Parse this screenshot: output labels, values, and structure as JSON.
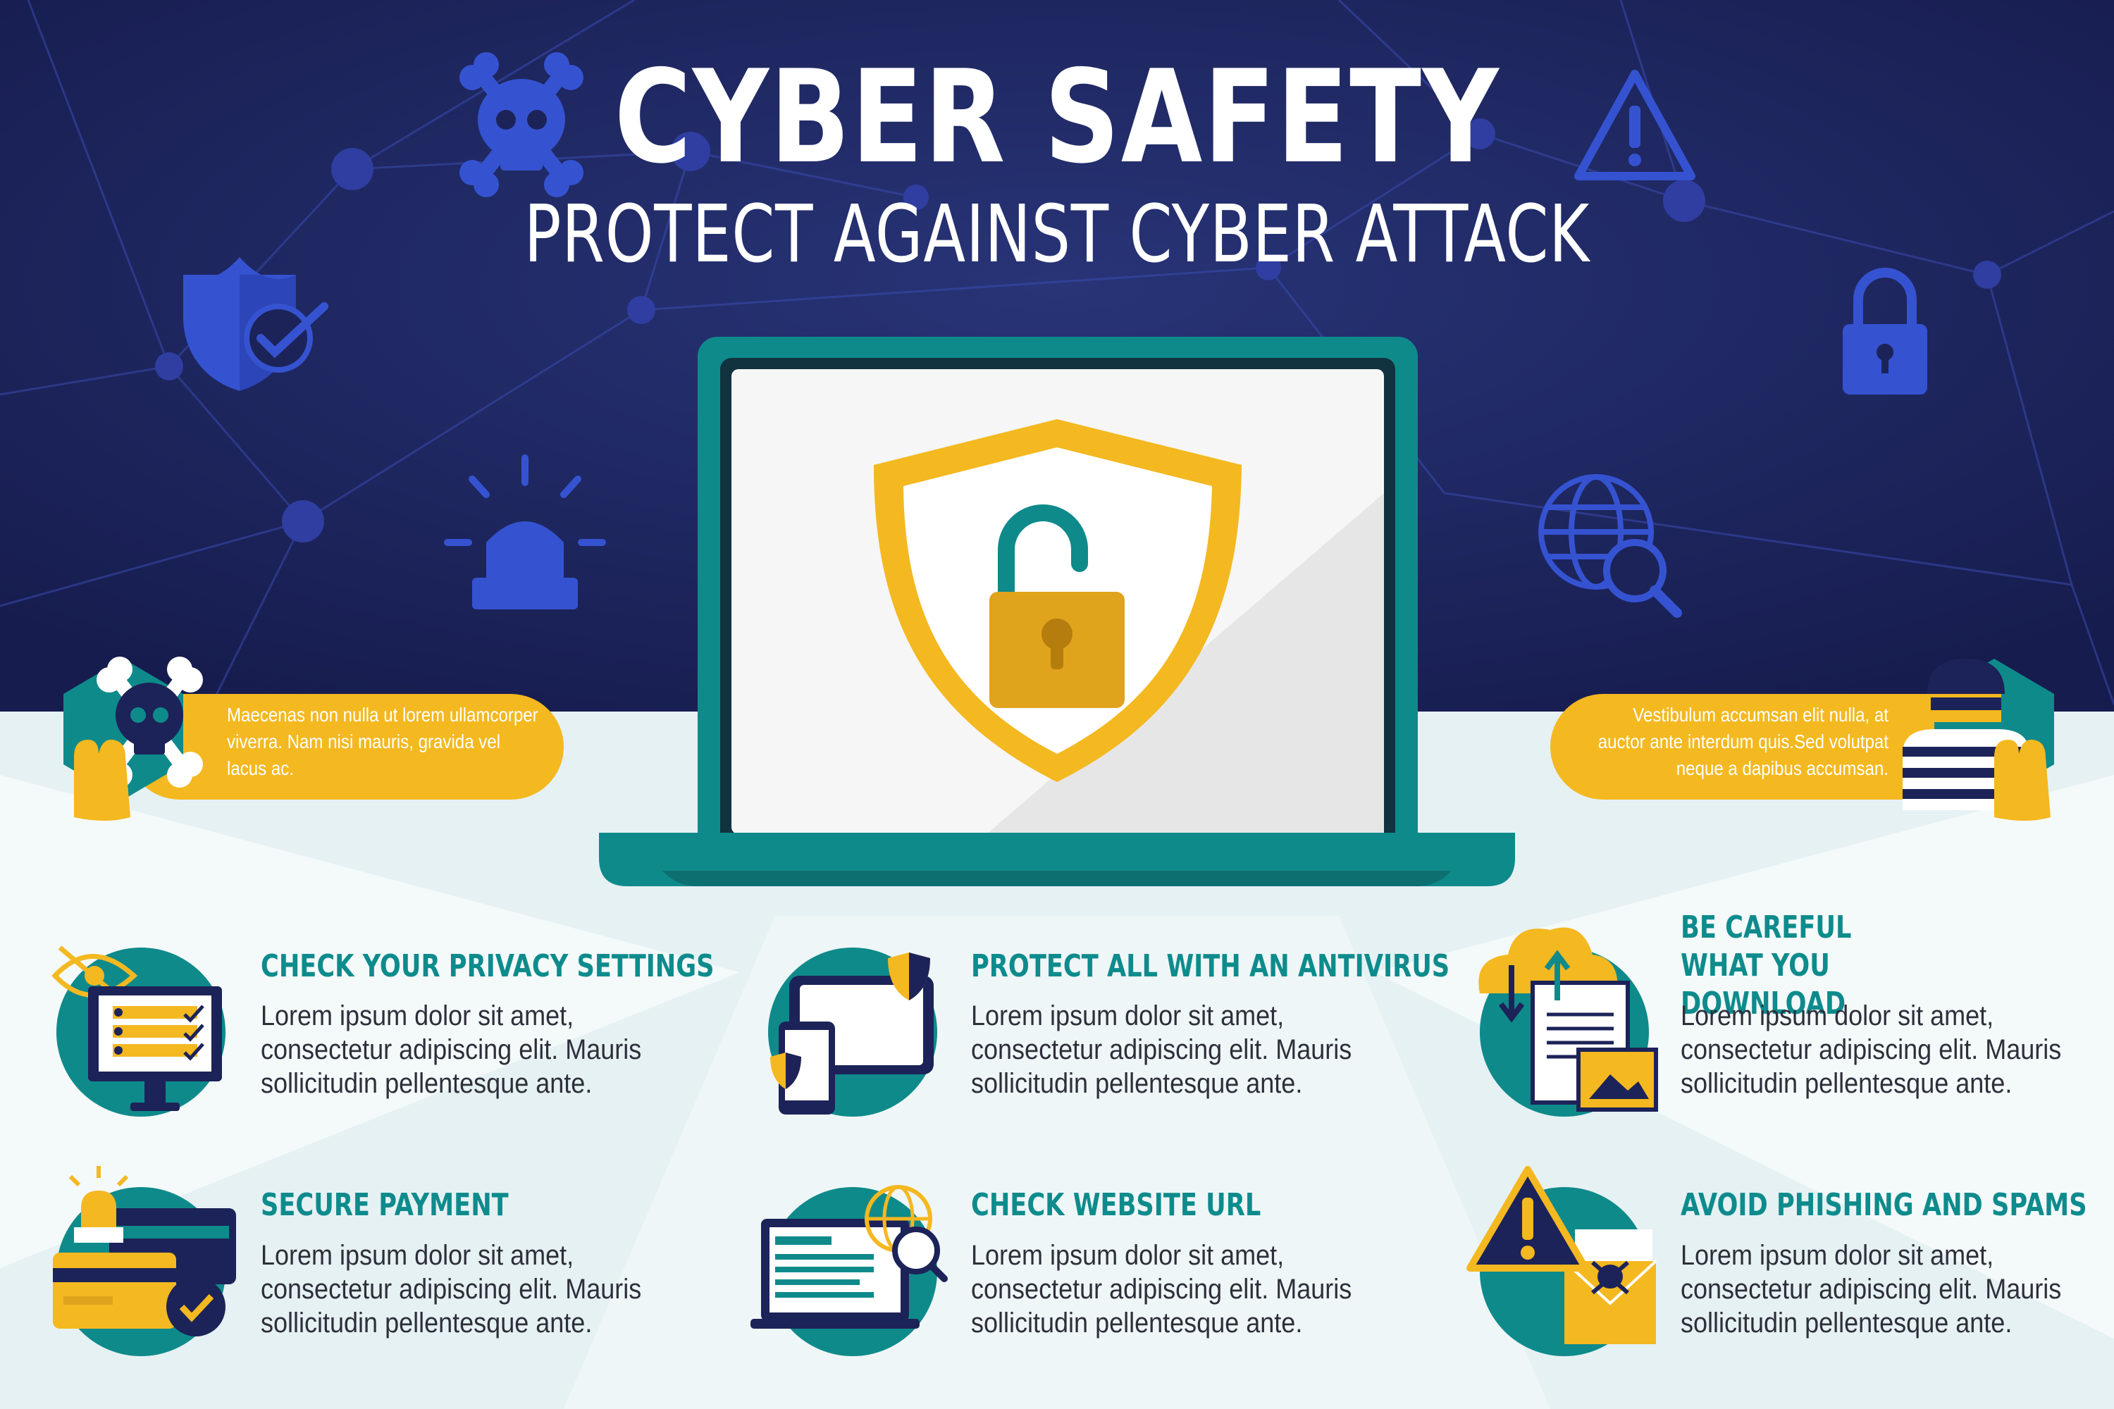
{
  "title": "CYBER SAFETY",
  "subtitle": "PROTECT AGAINST CYBER ATTACK",
  "callouts": {
    "left": "Maecenas non nulla ut lorem ullamcorper viverra. Nam nisi mauris, gravida vel lacus ac.",
    "right": "Vestibulum accumsan elit nulla, at auctor ante interdum quis.Sed volutpat neque a dapibus accumsan."
  },
  "features": [
    {
      "heading": "CHECK YOUR PRIVACY SETTINGS",
      "body": "Lorem ipsum dolor sit amet, consectetur adipiscing elit. Mauris sollicitudin pellentesque ante.",
      "icon": "privacy-settings-icon"
    },
    {
      "heading": "PROTECT ALL WITH AN ANTIVIRUS",
      "body": "Lorem ipsum dolor sit amet, consectetur adipiscing elit. Mauris sollicitudin pellentesque ante.",
      "icon": "antivirus-devices-icon"
    },
    {
      "heading": "BE CAREFUL WHAT YOU DOWNLOAD",
      "body": "Lorem ipsum dolor sit amet, consectetur adipiscing elit. Mauris sollicitudin pellentesque ante.",
      "icon": "cloud-download-icon"
    },
    {
      "heading": "SECURE PAYMENT",
      "body": "Lorem ipsum dolor sit amet, consectetur adipiscing elit. Mauris sollicitudin pellentesque ante.",
      "icon": "secure-payment-icon"
    },
    {
      "heading": "CHECK WEBSITE URL",
      "body": "Lorem ipsum dolor sit amet, consectetur adipiscing elit. Mauris sollicitudin pellentesque ante.",
      "icon": "website-url-icon"
    },
    {
      "heading": "AVOID PHISHING AND SPAMS",
      "body": "Lorem ipsum dolor sit amet, consectetur adipiscing elit. Mauris sollicitudin pellentesque ante.",
      "icon": "phishing-mail-icon"
    }
  ],
  "colors": {
    "navy": "#1c2358",
    "blue_icon": "#3553d1",
    "teal": "#0f8a8b",
    "teal_dark": "#0d6f70",
    "yellow": "#f4b820",
    "light_bg": "#e6f1f3",
    "body_text": "#2d2f3a"
  }
}
